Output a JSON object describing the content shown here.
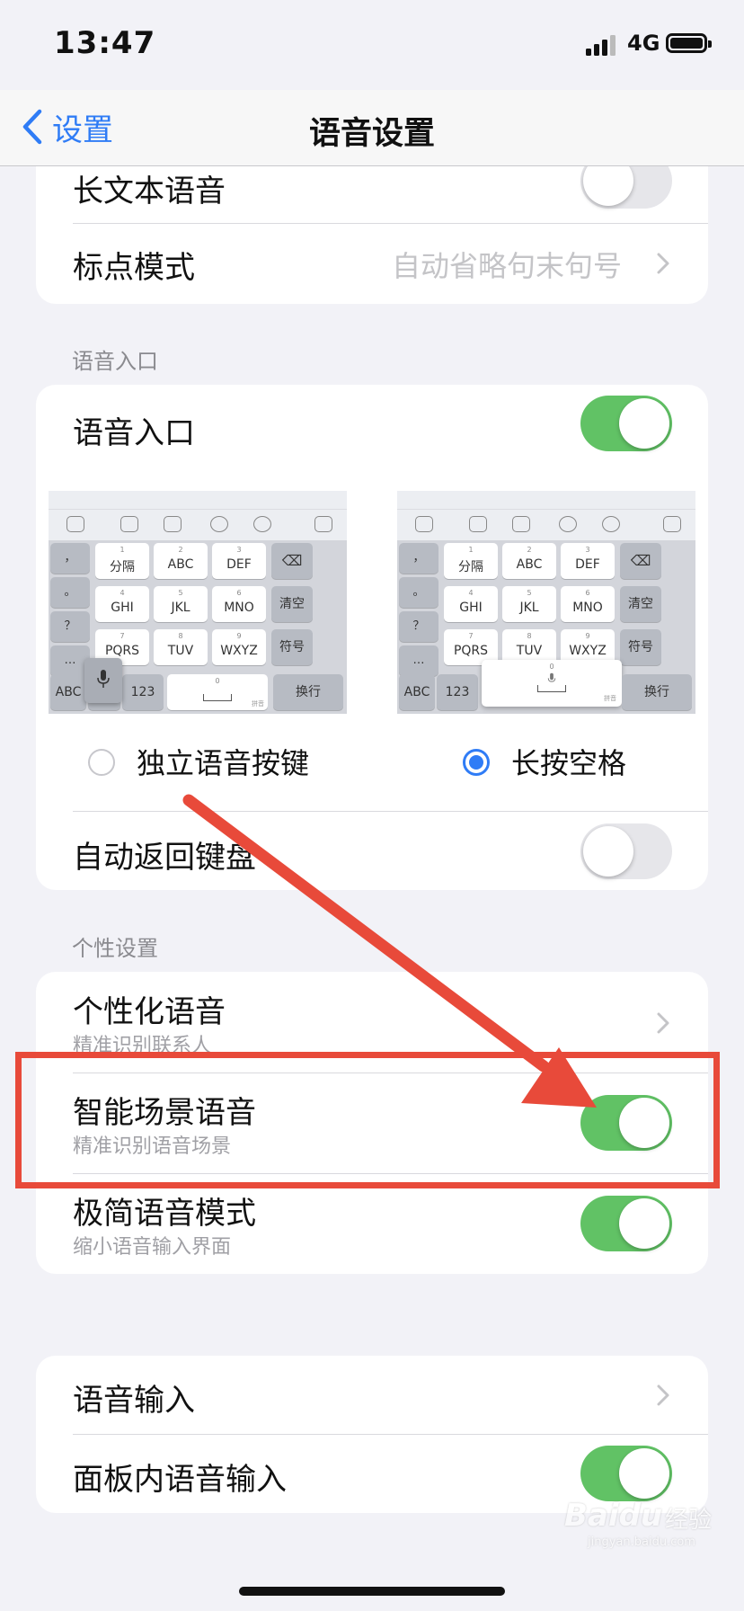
{
  "status": {
    "time": "13:47",
    "network": "4G"
  },
  "nav": {
    "back_label": "设置",
    "title": "语音设置"
  },
  "card1": {
    "long_text_label": "长文本语音",
    "long_text_on": false,
    "punct_label": "标点模式",
    "punct_value": "自动省略句末句号"
  },
  "voice_entry": {
    "section_title": "语音入口",
    "label": "语音入口",
    "on": true,
    "keyboard": {
      "left_keys": [
        "，",
        "。",
        "？",
        "…"
      ],
      "row1": [
        {
          "n": "1",
          "t": "分隔"
        },
        {
          "n": "2",
          "t": "ABC"
        },
        {
          "n": "3",
          "t": "DEF"
        }
      ],
      "row2": [
        {
          "n": "4",
          "t": "GHI"
        },
        {
          "n": "5",
          "t": "JKL"
        },
        {
          "n": "6",
          "t": "MNO"
        }
      ],
      "row3": [
        {
          "n": "7",
          "t": "PQRS"
        },
        {
          "n": "8",
          "t": "TUV"
        },
        {
          "n": "9",
          "t": "WXYZ"
        }
      ],
      "clear": "清空",
      "symbol": "符号",
      "abc": "ABC",
      "num": "123",
      "space_num": "0",
      "space_tag": "拼音",
      "enter": "换行"
    },
    "option_a": "独立语音按键",
    "option_b": "长按空格",
    "selected": "option_b",
    "auto_return_label": "自动返回键盘",
    "auto_return_on": false
  },
  "personal": {
    "section_title": "个性设置",
    "items": [
      {
        "label": "个性化语音",
        "sub": "精准识别联系人",
        "type": "chevron"
      },
      {
        "label": "智能场景语音",
        "sub": "精准识别语音场景",
        "type": "toggle",
        "on": true
      },
      {
        "label": "极简语音模式",
        "sub": "缩小语音输入界面",
        "type": "toggle",
        "on": true
      }
    ]
  },
  "card4": {
    "voice_input_label": "语音输入",
    "panel_voice_label": "面板内语音输入",
    "panel_voice_on": true
  },
  "watermark": {
    "text": "经验",
    "sub": "jingyan.baidu.com",
    "brand": "Baidu"
  },
  "colors": {
    "accent": "#2f7cf6",
    "toggle_on": "#61c265",
    "annotation": "#e84a3a"
  }
}
